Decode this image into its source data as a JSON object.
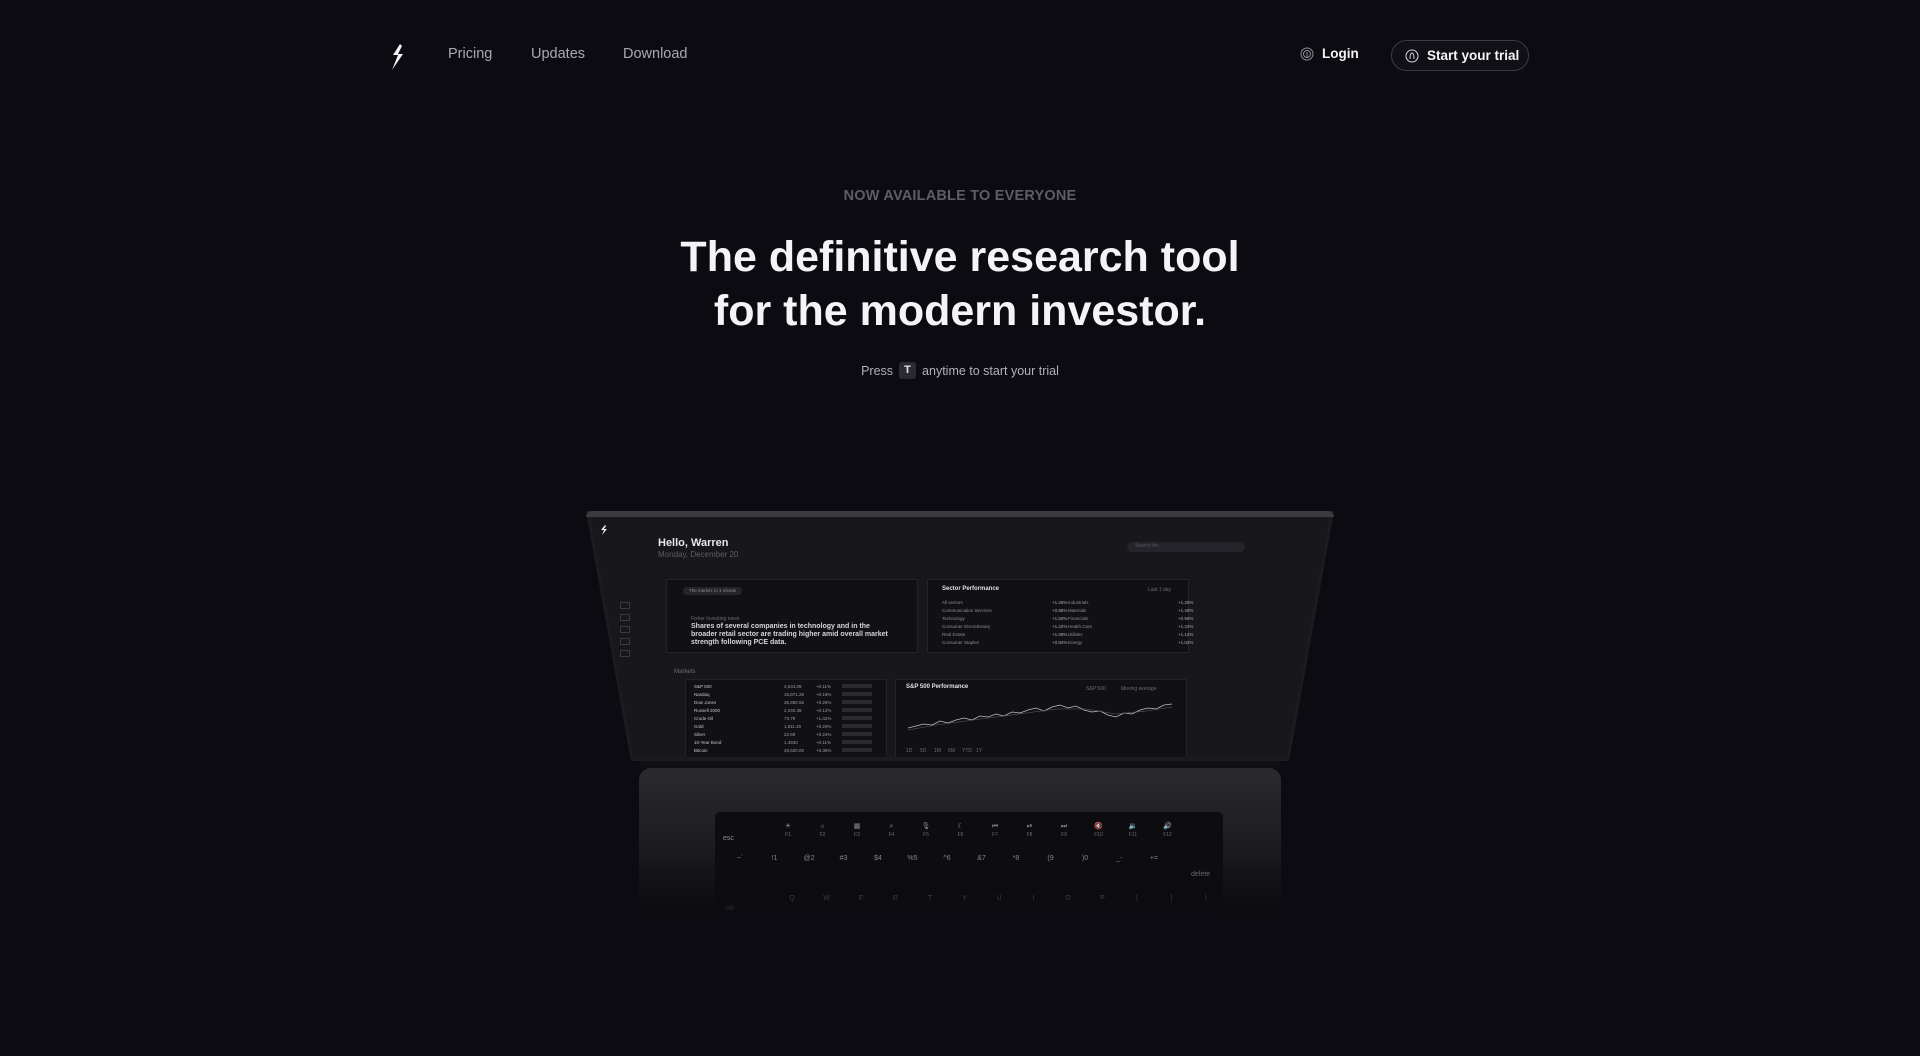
{
  "nav": {
    "links": [
      "Pricing",
      "Updates",
      "Download"
    ],
    "login_label": "Login",
    "trial_label": "Start your trial"
  },
  "hero": {
    "eyebrow": "NOW AVAILABLE TO EVERYONE",
    "headline_line1": "The definitive research tool",
    "headline_line2": "for the modern investor.",
    "press_prefix": "Press",
    "press_key": "T",
    "press_suffix": "anytime to start your trial"
  },
  "app": {
    "greeting": "Hello, Warren",
    "date": "Monday, December 20",
    "search_placeholder": "Search for...",
    "news_pill": "The market, in 1 minute",
    "news_source": "Fisher Investing news",
    "news_headline": "Shares of several companies in technology and in the broader retail sector are trading higher amid overall market strength following PCE data.",
    "sector_title": "Sector Performance",
    "sector_right": "Last 1 day",
    "sectors_left": [
      {
        "name": "All sectors",
        "value": "+1.26%"
      },
      {
        "name": "Communication Services",
        "value": "+0.85%"
      },
      {
        "name": "Technology",
        "value": "+1.50%"
      },
      {
        "name": "Consumer Discretionary",
        "value": "+1.22%"
      },
      {
        "name": "Real Estate",
        "value": "+1.08%"
      },
      {
        "name": "Consumer Staples",
        "value": "+0.84%"
      }
    ],
    "sectors_right": [
      {
        "name": "Industrials",
        "value": "+1.20%"
      },
      {
        "name": "Materials",
        "value": "+1.40%"
      },
      {
        "name": "Financials",
        "value": "+0.90%"
      },
      {
        "name": "Health Care",
        "value": "+1.22%"
      },
      {
        "name": "Utilities",
        "value": "+1.12%"
      },
      {
        "name": "Energy",
        "value": "+1.02%"
      }
    ],
    "markets_label": "Markets",
    "markets": [
      {
        "name": "S&P 500",
        "v1": "4,634.09",
        "v2": "+0.11%"
      },
      {
        "name": "Nasdaq",
        "v1": "15,871.26",
        "v2": "+0.19%"
      },
      {
        "name": "Dow Jones",
        "v1": "35,950.56",
        "v2": "+0.26%"
      },
      {
        "name": "Russell 2000",
        "v1": "2,245.38",
        "v2": "+0.12%"
      },
      {
        "name": "Crude Oil",
        "v1": "73.79",
        "v2": "+1.42%"
      },
      {
        "name": "Gold",
        "v1": "1,811.20",
        "v2": "+0.20%"
      },
      {
        "name": "Silver",
        "v1": "22.89",
        "v2": "+0.24%"
      },
      {
        "name": "10-Year Bond",
        "v1": "1.4930",
        "v2": "+0.11%"
      },
      {
        "name": "Bitcoin",
        "v1": "48,620.00",
        "v2": "+0.35%"
      }
    ],
    "chart_title": "S&P 500 Performance",
    "chart_legend": [
      "S&P 500",
      "Moving average"
    ],
    "chart_ranges": [
      "1D",
      "5D",
      "1M",
      "6M",
      "YTD",
      "1Y"
    ]
  },
  "keyboard": {
    "fn_row": [
      "☀",
      "☼",
      "▦",
      "⌕",
      "🎙",
      "☾",
      "⏮",
      "⏯",
      "⏭",
      "🔇",
      "🔉",
      "🔊"
    ],
    "fn_sub": [
      "F1",
      "F2",
      "F3",
      "F4",
      "F5",
      "F6",
      "F7",
      "F8",
      "F9",
      "F10",
      "F11",
      "F12"
    ],
    "esc": "esc",
    "num_row": [
      {
        "top": "~",
        "bottom": "`"
      },
      {
        "top": "!",
        "bottom": "1"
      },
      {
        "top": "@",
        "bottom": "2"
      },
      {
        "top": "#",
        "bottom": "3"
      },
      {
        "top": "$",
        "bottom": "4"
      },
      {
        "top": "%",
        "bottom": "5"
      },
      {
        "top": "^",
        "bottom": "6"
      },
      {
        "top": "&",
        "bottom": "7"
      },
      {
        "top": "*",
        "bottom": "8"
      },
      {
        "top": "(",
        "bottom": "9"
      },
      {
        "top": ")",
        "bottom": "0"
      },
      {
        "top": "_",
        "bottom": "-"
      },
      {
        "top": "+",
        "bottom": "="
      }
    ],
    "delete": "delete",
    "tab": "tab",
    "letter_row": [
      "Q",
      "W",
      "E",
      "R",
      "T",
      "Y",
      "U",
      "I",
      "O",
      "P",
      "[",
      "]",
      "\\"
    ]
  }
}
